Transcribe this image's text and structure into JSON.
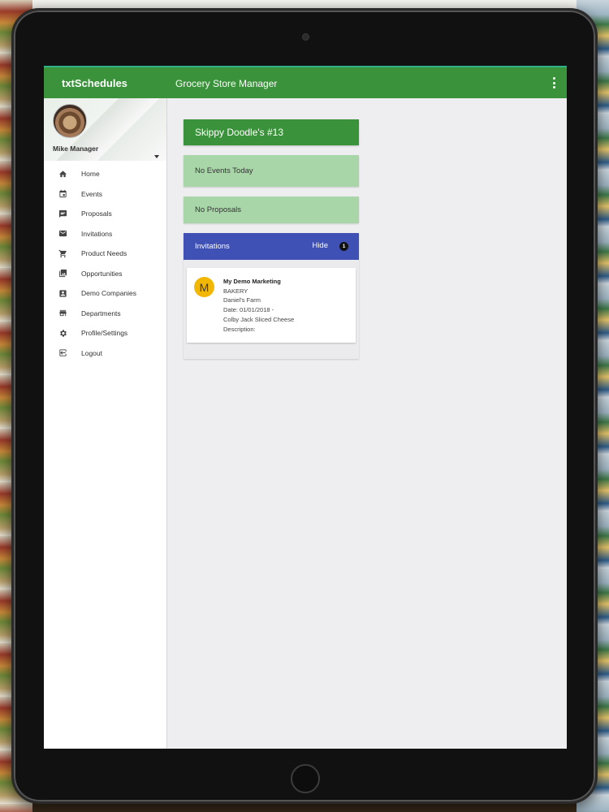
{
  "app": {
    "name": "txtSchedules",
    "screen_title": "Grocery Store Manager"
  },
  "profile": {
    "name": "Mike Manager"
  },
  "sidebar": {
    "items": [
      {
        "label": "Home",
        "icon": "home-icon"
      },
      {
        "label": "Events",
        "icon": "calendar-icon"
      },
      {
        "label": "Proposals",
        "icon": "proposal-icon"
      },
      {
        "label": "Invitations",
        "icon": "mail-icon"
      },
      {
        "label": "Product Needs",
        "icon": "cart-icon"
      },
      {
        "label": "Opportunities",
        "icon": "photo-library-icon"
      },
      {
        "label": "Demo Companies",
        "icon": "contact-icon"
      },
      {
        "label": "Departments",
        "icon": "store-icon"
      },
      {
        "label": "Profile/Settings",
        "icon": "gear-icon"
      },
      {
        "label": "Logout",
        "icon": "logout-icon"
      }
    ]
  },
  "main": {
    "store_name": "Skippy Doodle's #13",
    "events_status": "No Events Today",
    "proposals_status": "No Proposals",
    "invitations": {
      "title": "Invitations",
      "hide_label": "Hide",
      "count": "1",
      "items": [
        {
          "avatar_letter": "M",
          "company": "My Demo Marketing",
          "department": "BAKERY",
          "vendor": "Daniel's Farm",
          "date": "Date: 01/01/2018 -",
          "product": "Colby Jack Sliced Cheese",
          "description": "Description:"
        }
      ]
    }
  },
  "colors": {
    "primary_green": "#3a933a",
    "light_green": "#a9d6a9",
    "indigo": "#3f51b5",
    "avatar_yellow": "#f2b705"
  }
}
